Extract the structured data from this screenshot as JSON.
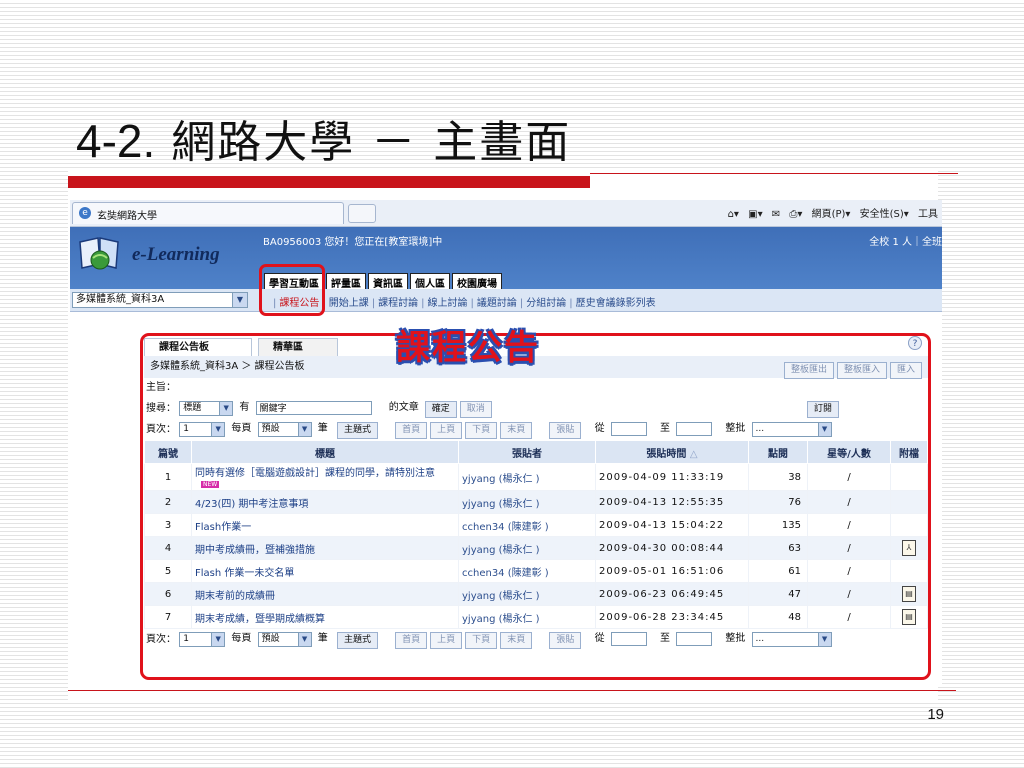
{
  "slide": {
    "title_num": "4-2.",
    "title_text": "網路大學 － 主畫面",
    "page_number": "19",
    "callout": "課程公告"
  },
  "browser": {
    "tab_title": "玄奘網路大學",
    "tools": [
      "網頁(P)▾",
      "安全性(S)▾",
      "工具"
    ]
  },
  "site": {
    "logo_text": "e-Learning",
    "welcome": "BA0956003 您好！您正在[教室環境]中",
    "online": "全校 1 人｜全班",
    "main_tabs": [
      "學習互動區",
      "評量區",
      "資訊區",
      "個人區",
      "校園廣場"
    ],
    "course_select": "多媒體系統_資科3A",
    "sub_nav": [
      "課程公告",
      "開始上課",
      "課程討論",
      "線上討論",
      "議題討論",
      "分組討論",
      "歷史會議錄影列表"
    ]
  },
  "board": {
    "tabs": [
      "課程公告板",
      "精華區"
    ],
    "breadcrumb": "多媒體系統_資科3A ＞ 課程公告板",
    "export_btn": "整板匯出",
    "import_btn": "整板匯入",
    "import2_btn": "匯入",
    "subject_label": "主旨：",
    "search_label": "搜尋：",
    "search_field": "標題",
    "has_label": "有",
    "keyword": "關鍵字",
    "article_label": "的文章",
    "confirm_btn": "確定",
    "cancel_btn": "取消",
    "subscribe_btn": "訂閱",
    "pager": {
      "page_label": "頁次：",
      "page_value": "1",
      "per_page_label": "每頁",
      "per_page_value": "預設",
      "unit_label": "筆",
      "topic_btn": "主題式",
      "first_btn": "首頁",
      "prev_btn": "上頁",
      "next_btn": "下頁",
      "last_btn": "末頁",
      "post_btn": "張貼",
      "from_label": "從",
      "to_label": "至",
      "batch_label": "整批",
      "batch_value": "..."
    },
    "columns": [
      "篇號",
      "標題",
      "張貼者",
      "張貼時間",
      "點閱",
      "星等/人數",
      "附檔"
    ],
    "sort_indicator": "△",
    "posts": [
      {
        "no": "1",
        "title": "同時有選修［電腦遊戲設計］課程的同學，請特別注意",
        "new_badge": "NEW",
        "poster": "yjyang (楊永仁 )",
        "time": "2009-04-09 11:33:19",
        "hits": "38",
        "rating": "/",
        "attach": ""
      },
      {
        "no": "2",
        "title": "4/23(四) 期中考注意事項",
        "new_badge": "",
        "poster": "yjyang (楊永仁 )",
        "time": "2009-04-13 12:55:35",
        "hits": "76",
        "rating": "/",
        "attach": ""
      },
      {
        "no": "3",
        "title": "Flash作業一",
        "new_badge": "",
        "poster": "cchen34 (陳建彰 )",
        "time": "2009-04-13 15:04:22",
        "hits": "135",
        "rating": "/",
        "attach": ""
      },
      {
        "no": "4",
        "title": "期中考成績冊，暨補強措施",
        "new_badge": "",
        "poster": "yjyang (楊永仁 )",
        "time": "2009-04-30 00:08:44",
        "hits": "63",
        "rating": "/",
        "attach": "pdf-icon"
      },
      {
        "no": "5",
        "title": "Flash 作業一未交名單",
        "new_badge": "",
        "poster": "cchen34 (陳建彰 )",
        "time": "2009-05-01 16:51:06",
        "hits": "61",
        "rating": "/",
        "attach": ""
      },
      {
        "no": "6",
        "title": "期末考前的成績冊",
        "new_badge": "",
        "poster": "yjyang (楊永仁 )",
        "time": "2009-06-23 06:49:45",
        "hits": "47",
        "rating": "/",
        "attach": "image-icon"
      },
      {
        "no": "7",
        "title": "期末考成績，暨學期成績概算",
        "new_badge": "",
        "poster": "yjyang (楊永仁 )",
        "time": "2009-06-28 23:34:45",
        "hits": "48",
        "rating": "/",
        "attach": "image-icon"
      }
    ]
  },
  "colors": {
    "accent_red": "#c8141b",
    "header_blue": "#4f82c9"
  }
}
